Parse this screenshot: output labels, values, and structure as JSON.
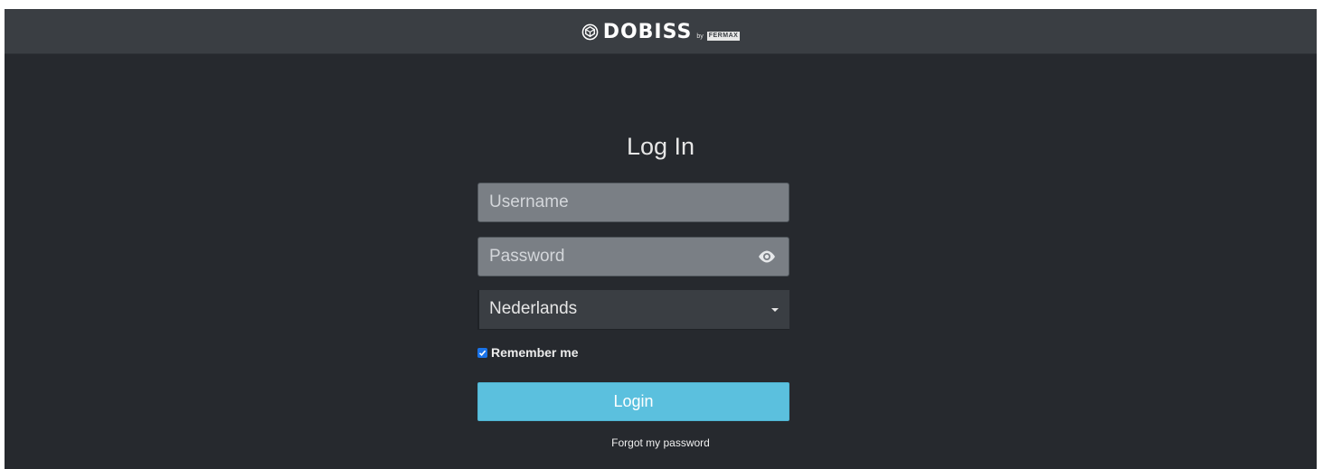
{
  "header": {
    "logo_text": "DOBISS",
    "logo_by": "by",
    "logo_brand": "FERMAX"
  },
  "login": {
    "title": "Log In",
    "username_placeholder": "Username",
    "password_placeholder": "Password",
    "language_selected": "Nederlands",
    "remember_label": "Remember me",
    "remember_checked": true,
    "login_button": "Login",
    "forgot_link": "Forgot my password"
  },
  "icons": {
    "logo": "dobiss-logo-icon",
    "password_toggle": "eye-icon",
    "select_caret": "caret-down-icon",
    "checkbox": "checkmark-icon"
  },
  "colors": {
    "page_background": "#26292e",
    "header_background": "#3a3e43",
    "input_background": "#7a7f85",
    "login_button": "#5bc0de",
    "checkbox_accent": "#1a73e8"
  }
}
